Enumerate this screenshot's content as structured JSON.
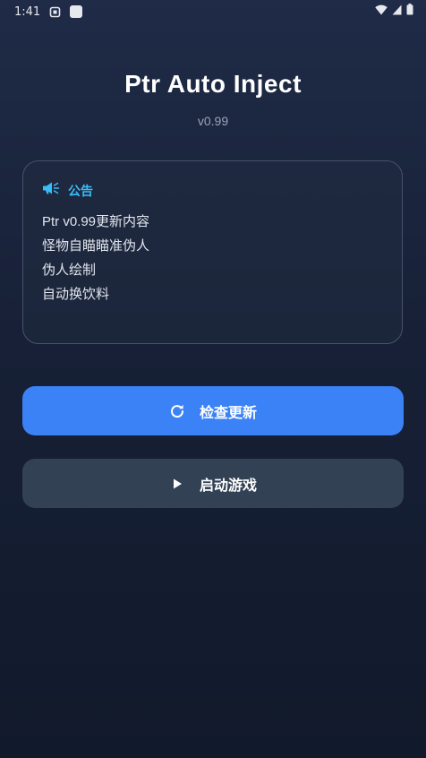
{
  "status_bar": {
    "time": "1:41"
  },
  "header": {
    "title": "Ptr Auto Inject",
    "version": "v0.99"
  },
  "notice": {
    "icon": "megaphone-icon",
    "title": "公告",
    "lines": [
      "Ptr v0.99更新内容",
      "怪物自瞄瞄准伪人",
      "伪人绘制",
      "自动换饮料"
    ]
  },
  "buttons": {
    "check_update": {
      "icon": "refresh-icon",
      "label": "检查更新"
    },
    "launch_game": {
      "icon": "play-icon",
      "label": "启动游戏"
    }
  },
  "colors": {
    "accent_blue": "#3b82f6",
    "notice_cyan": "#38bdf8",
    "secondary_button": "#334155",
    "background_top": "#1f2b47",
    "background_bottom": "#111a2b"
  }
}
